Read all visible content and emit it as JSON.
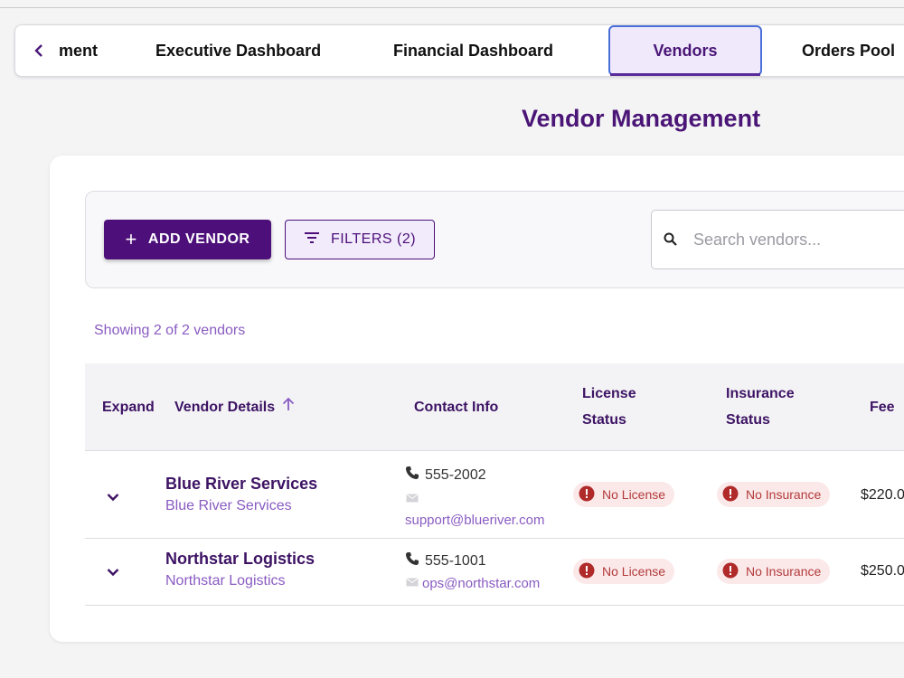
{
  "tabs": {
    "back_icon": "chevron-left-icon",
    "items": [
      {
        "label": "ment"
      },
      {
        "label": "Executive Dashboard"
      },
      {
        "label": "Financial Dashboard"
      },
      {
        "label": "Vendors"
      },
      {
        "label": "Orders Pool"
      }
    ],
    "active_index": 3
  },
  "page": {
    "title": "Vendor Management"
  },
  "toolbar": {
    "add_label": "ADD VENDOR",
    "filter_label": "FILTERS (2)",
    "search_placeholder": "Search vendors..."
  },
  "summary": {
    "showing": "Showing 2 of 2 vendors"
  },
  "table": {
    "headers": {
      "expand": "Expand",
      "vendor": "Vendor Details",
      "contact": "Contact Info",
      "license": "License Status",
      "insurance": "Insurance Status",
      "fee": "Fee"
    },
    "rows": [
      {
        "name": "Blue River Services",
        "subname": "Blue River Services",
        "phone": "555-2002",
        "email": "support@blueriver.com",
        "license": "No License",
        "insurance": "No Insurance",
        "fee": "$220.0"
      },
      {
        "name": "Northstar Logistics",
        "subname": "Northstar Logistics",
        "phone": "555-1001",
        "email": "ops@northstar.com",
        "license": "No License",
        "insurance": "No Insurance",
        "fee": "$250.0"
      }
    ]
  },
  "colors": {
    "brand": "#4d0f7a",
    "accent_light": "#efe9fb",
    "link": "#8a5cc2",
    "error_bg": "#fbe9ea",
    "error": "#b33a3a"
  }
}
